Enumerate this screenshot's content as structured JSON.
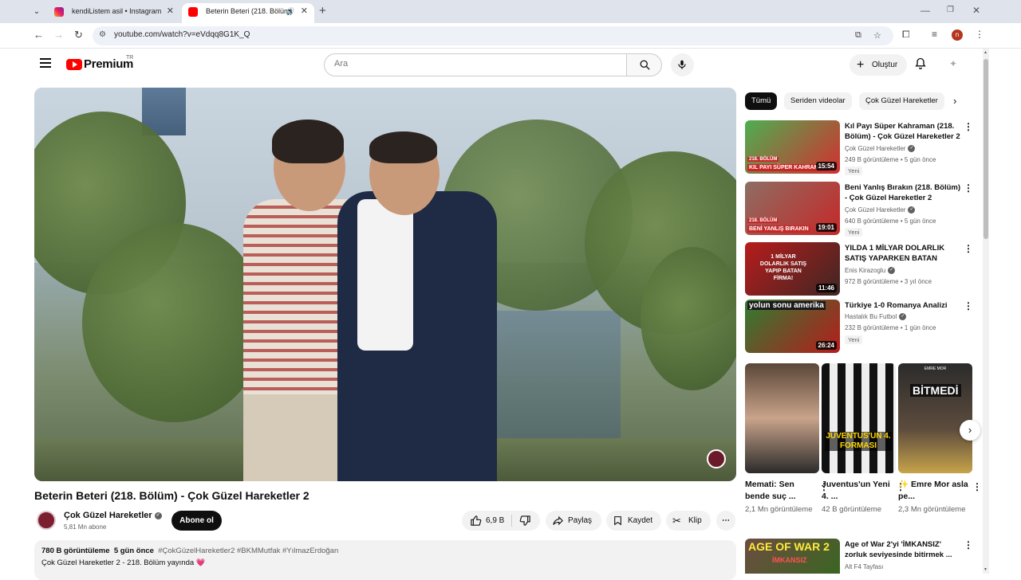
{
  "browser": {
    "tabs": [
      {
        "title": "kendiListem asil • Instagram",
        "active": false
      },
      {
        "title": "Beterin Beteri (218. Bölüm)",
        "active": true
      }
    ],
    "url": "youtube.com/watch?v=eVdqq8G1K_Q",
    "profile_initial": "n"
  },
  "youtube": {
    "logo_text": "Premium",
    "country_code": "TR",
    "search_placeholder": "Ara",
    "create_label": "Oluştur"
  },
  "video": {
    "title": "Beterin Beteri (218. Bölüm) - Çok Güzel Hareketler 2",
    "channel": "Çok Güzel Hareketler",
    "subscribers": "5,81 Mn abone",
    "subscribe_label": "Abone ol",
    "likes": "6,9 B",
    "share_label": "Paylaş",
    "save_label": "Kaydet",
    "clip_label": "Klip",
    "views": "780 B görüntüleme",
    "age": "5 gün önce",
    "hashtags": "#ÇokGüzelHareketler2 #BKMMutfak #YılmazErdoğan",
    "description_line": "Çok Güzel Hareketler 2 - 218. Bölüm yayında 💗"
  },
  "chips": [
    "Tümü",
    "Seriden videolar",
    "Çok Güzel Hareketler"
  ],
  "recommendations": [
    {
      "title": "Kıl Payı Süper Kahraman (218. Bölüm) - Çok Güzel Hareketler 2",
      "channel": "Çok Güzel Hareketler",
      "meta": "249 B görüntüleme • 5 gün önce",
      "badge": "Yeni",
      "duration": "15:54",
      "thumb_text": "KIL PAYI SÜPER KAHRAMAN",
      "episode": "218. BÖLÜM"
    },
    {
      "title": "Beni Yanlış Bırakın (218. Bölüm) - Çok Güzel Hareketler 2",
      "channel": "Çok Güzel Hareketler",
      "meta": "640 B görüntüleme • 5 gün önce",
      "badge": "Yeni",
      "duration": "19:01",
      "thumb_text": "BENİ YANLIŞ BIRAKIN",
      "episode": "218. BÖLÜM"
    },
    {
      "title": "YILDA 1 MİLYAR DOLARLIK SATIŞ YAPARKEN BATAN OYU...",
      "channel": "Enis Kirazoglu",
      "meta": "972 B görüntüleme • 3 yıl önce",
      "badge": "",
      "duration": "11:46",
      "thumb_text": "1 MİLYAR DOLARLIK SATIŞ YAPIP BATAN FİRMA!",
      "episode": ""
    },
    {
      "title": "Türkiye 1-0 Romanya Analizi",
      "channel": "Hastalık Bu Futbol",
      "meta": "232 B görüntüleme • 1 gün önce",
      "badge": "Yeni",
      "duration": "26:24",
      "thumb_text": "yolun sonu amerika",
      "episode": ""
    }
  ],
  "shorts": [
    {
      "title": "Memati: Sen bende suç ...",
      "views": "2,1 Mn görüntüleme"
    },
    {
      "title": "Juventus'un Yeni 4. ...",
      "views": "42 B görüntüleme",
      "thumb_text": "JUVENTUS'UN 4. FORMASI"
    },
    {
      "title": "✨ Emre Mor asla pe...",
      "views": "2,3 Mn görüntüleme",
      "thumb_text": "BİTMEDİ",
      "thumb_small": "EMRE MOR"
    }
  ],
  "next_rec": {
    "title": "Age of War 2'yi 'İMKANSIZ' zorluk seviyesinde bitirmek ...",
    "channel": "Alt F4 Tayfası",
    "thumb_text": "AGE OF WAR 2",
    "thumb_sub": "İMKANSIZ"
  }
}
